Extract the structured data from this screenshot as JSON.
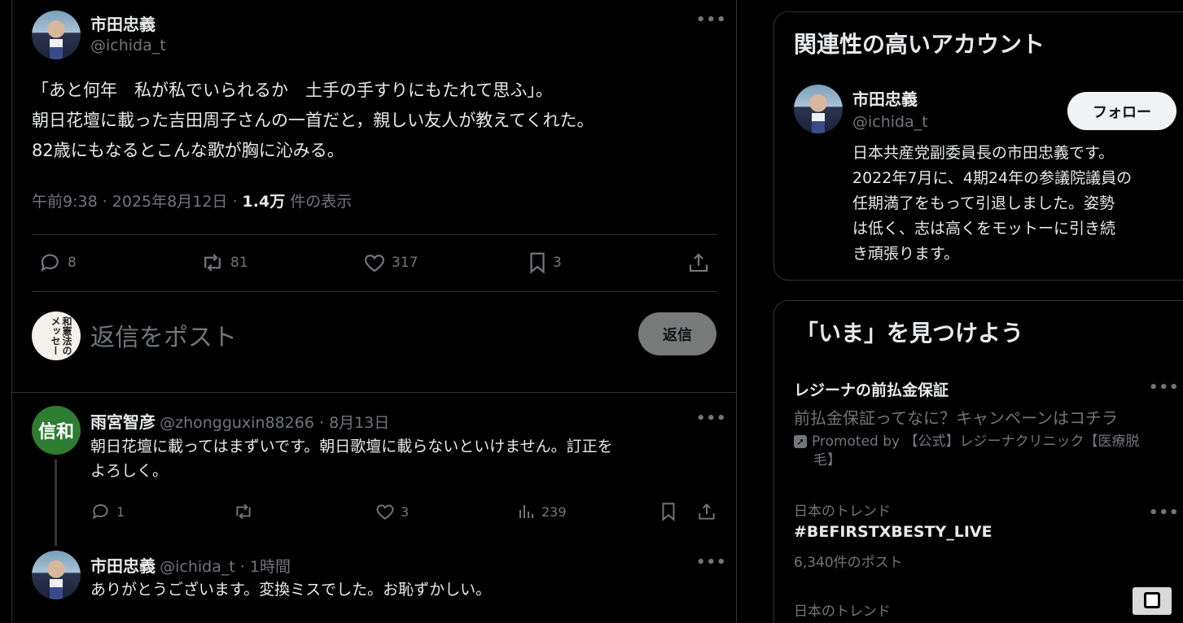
{
  "main_tweet": {
    "author_name": "市田忠義",
    "author_handle": "@ichida_t",
    "text_lines": [
      "「あと何年　私が私でいられるか　土手の手すりにもたれて思ふ」。",
      "朝日花壇に載った吉田周子さんの一首だと，親しい友人が教えてくれた。",
      "82歳にもなるとこんな歌が胸に沁みる。"
    ],
    "time": "午前9:38 · 2025年8月12日 · ",
    "views_count": "1.4万",
    "views_label": " 件の表示",
    "stats": {
      "replies": "8",
      "reposts": "81",
      "likes": "317",
      "bookmarks": "3"
    }
  },
  "composer": {
    "placeholder": "返信をポスト",
    "reply_button": "返信",
    "avatar_text": "和憲法のメッセー"
  },
  "replies": [
    {
      "avatar_text": "信和",
      "author_name": "雨宮智彦",
      "meta": "@zhongguxin88266 · 8月13日",
      "text_lines": [
        "朝日花壇に載ってはまずいです。朝日歌壇に載らないといけません。訂正を",
        "よろしく。"
      ],
      "stats": {
        "replies": "1",
        "reposts": "",
        "likes": "3",
        "views": "239"
      }
    },
    {
      "author_name": "市田忠義",
      "meta": "@ichida_t · 1時間",
      "text_lines": [
        "ありがとうございます。変換ミスでした。お恥ずかしい。"
      ]
    }
  ],
  "sidebar": {
    "relevant": {
      "title": "関連性の高いアカウント",
      "name": "市田忠義",
      "handle": "@ichida_t",
      "follow_label": "フォロー",
      "bio_lines": [
        "日本共産党副委員長の市田忠義です。",
        "2022年7月に、4期24年の参議院議員の",
        "任期満了をもって引退しました。姿勢",
        "は低く、志は高くをモットーに引き続",
        "き頑張ります。"
      ]
    },
    "discover": {
      "title": "「いま」を見つけよう",
      "items": [
        {
          "title": "レジーナの前払金保証",
          "desc": "前払金保証ってなに？キャンペーンはコチラ",
          "promoted_lines": [
            "Promoted by 【公式】レジーナクリニック【医療脱",
            "毛】"
          ]
        },
        {
          "category": "日本のトレンド",
          "title": "#BEFIRSTXBESTY_LIVE",
          "posts": "6,340件のポスト"
        },
        {
          "category": "日本のトレンド"
        }
      ]
    }
  },
  "colors": {
    "background": "#000000",
    "text": "#e7e9ea",
    "muted": "#71767b",
    "border": "#2f3336",
    "reply_avatar_green": "#2e7d32"
  },
  "icons": [
    "reply-icon",
    "repost-icon",
    "like-icon",
    "bookmark-icon",
    "share-icon",
    "views-icon",
    "more-icon",
    "promoted-icon"
  ]
}
